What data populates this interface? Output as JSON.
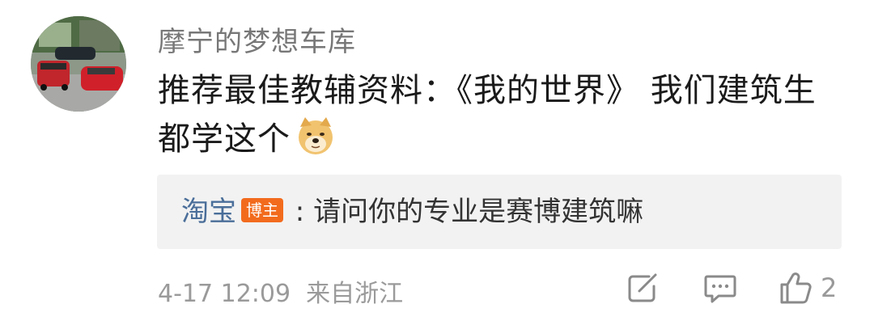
{
  "comment": {
    "author": "摩宁的梦想车库",
    "text": "推荐最佳教辅资料：《我的世界》 我们建筑生都学这个",
    "emoji": "doge-emoji",
    "reply": {
      "name": "淘宝",
      "badge": "博主",
      "separator": " : ",
      "text": "请问你的专业是赛博建筑嘛"
    },
    "meta": {
      "time": "4-17 12:09",
      "source": "来自浙江"
    },
    "actions": {
      "share_icon": "share-edit-icon",
      "comment_icon": "comment-icon",
      "like_icon": "thumbs-up-icon",
      "like_count": "2"
    }
  },
  "colors": {
    "badge": "#f26b1d",
    "reply_name": "#4a6e99",
    "reply_bg": "#f2f2f2",
    "meta": "#9a9a9a"
  }
}
